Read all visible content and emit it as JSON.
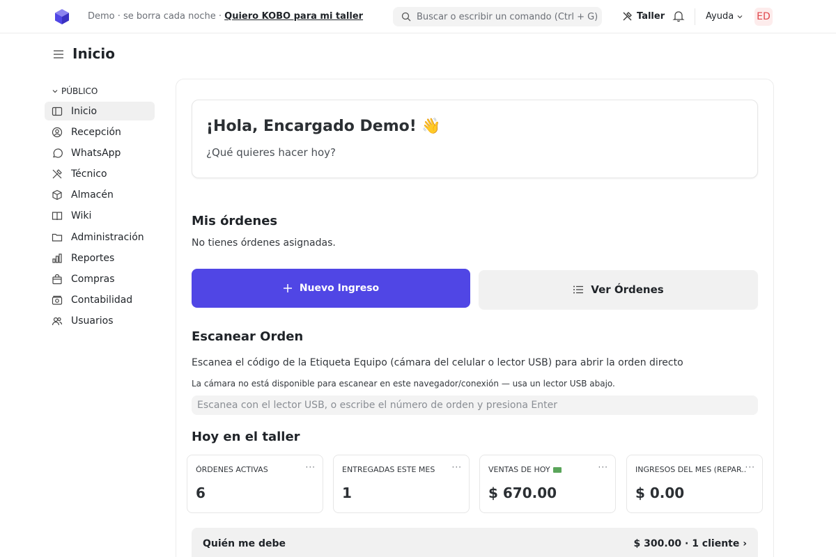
{
  "topbar": {
    "demo_note": "Demo · se borra cada noche ·",
    "demo_link": "Quiero KOBO para mi taller",
    "search_placeholder": "Buscar o escribir un comando (Ctrl + G)",
    "taller_label": "Taller",
    "ayuda_label": "Ayuda",
    "avatar_initials": "ED",
    "colors": {
      "logo": "#5046e5",
      "avatar_text": "#e0464b",
      "avatar_bg": "#fdecec"
    }
  },
  "page": {
    "title": "Inicio"
  },
  "sidebar": {
    "section_label": "PÚBLICO",
    "items": [
      {
        "label": "Inicio",
        "icon": "sidebar-layout-icon",
        "active": true
      },
      {
        "label": "Recepción",
        "icon": "user-circle-icon"
      },
      {
        "label": "WhatsApp",
        "icon": "chat-bubble-icon"
      },
      {
        "label": "Técnico",
        "icon": "tools-icon"
      },
      {
        "label": "Almacén",
        "icon": "package-icon"
      },
      {
        "label": "Wiki",
        "icon": "book-icon"
      },
      {
        "label": "Administración",
        "icon": "folder-icon"
      },
      {
        "label": "Reportes",
        "icon": "bar-chart-icon"
      },
      {
        "label": "Compras",
        "icon": "shopping-bag-icon"
      },
      {
        "label": "Contabilidad",
        "icon": "cash-icon"
      },
      {
        "label": "Usuarios",
        "icon": "users-icon"
      }
    ]
  },
  "main": {
    "greeting": "¡Hola, Encargado Demo! 👋",
    "greeting_sub": "¿Qué quieres hacer hoy?",
    "orders_title": "Mis órdenes",
    "orders_empty": "No tienes órdenes asignadas.",
    "btn_new": "Nuevo Ingreso",
    "btn_view": "Ver Órdenes",
    "scan_title": "Escanear Orden",
    "scan_desc": "Escanea el código de la Etiqueta Equipo (cámara del celular o lector USB) para abrir la orden directo",
    "scan_note": "La cámara no está disponible para escanear en este navegador/conexión — usa un lector USB abajo.",
    "scan_placeholder": "Escanea con el lector USB, o escribe el número de orden y presiona Enter",
    "today_title": "Hoy en el taller",
    "stats": [
      {
        "label": "ÓRDENES ACTIVAS",
        "value": "6"
      },
      {
        "label": "ENTREGADAS ESTE MES",
        "value": "1"
      },
      {
        "label": "VENTAS DE HOY",
        "value": "$ 670.00",
        "icon": "money-icon"
      },
      {
        "label": "INGRESOS DEL MES (REPAR...",
        "value": "$ 0.00"
      }
    ],
    "stat_menu": "···",
    "debt_title": "Quién me debe",
    "debt_amount": "$ 300.00 · 1 cliente ›",
    "colors": {
      "primary": "#5046e5"
    }
  }
}
